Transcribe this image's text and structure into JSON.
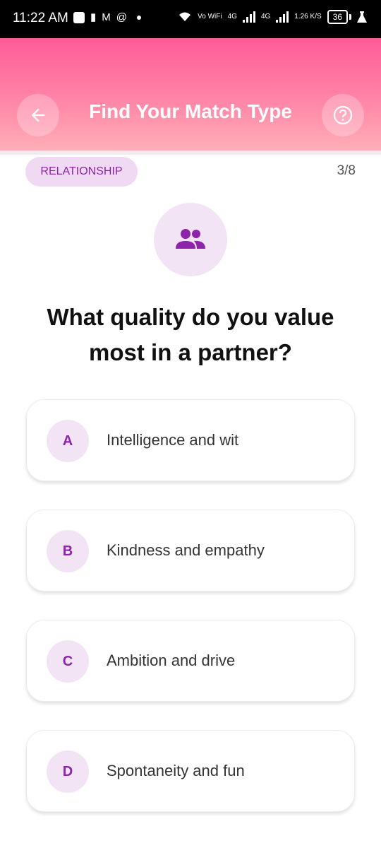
{
  "status_bar": {
    "time": "11:22 AM",
    "network_labels": [
      "Vo WiFi",
      "4G",
      "4G"
    ],
    "speed": "1.26 K/S",
    "battery": "36"
  },
  "header": {
    "title": "Find Your Match Type",
    "gradient_colors": [
      "#ff5c97",
      "#ffaeb8"
    ]
  },
  "quiz": {
    "category": "RELATIONSHIP",
    "progress": "3/8",
    "question": "What quality do you value most in a partner?",
    "icon": "people-icon",
    "accent_color": "#8e24aa",
    "options": [
      {
        "letter": "A",
        "text": "Intelligence and wit"
      },
      {
        "letter": "B",
        "text": "Kindness and empathy"
      },
      {
        "letter": "C",
        "text": "Ambition and drive"
      },
      {
        "letter": "D",
        "text": "Spontaneity and fun"
      }
    ]
  }
}
